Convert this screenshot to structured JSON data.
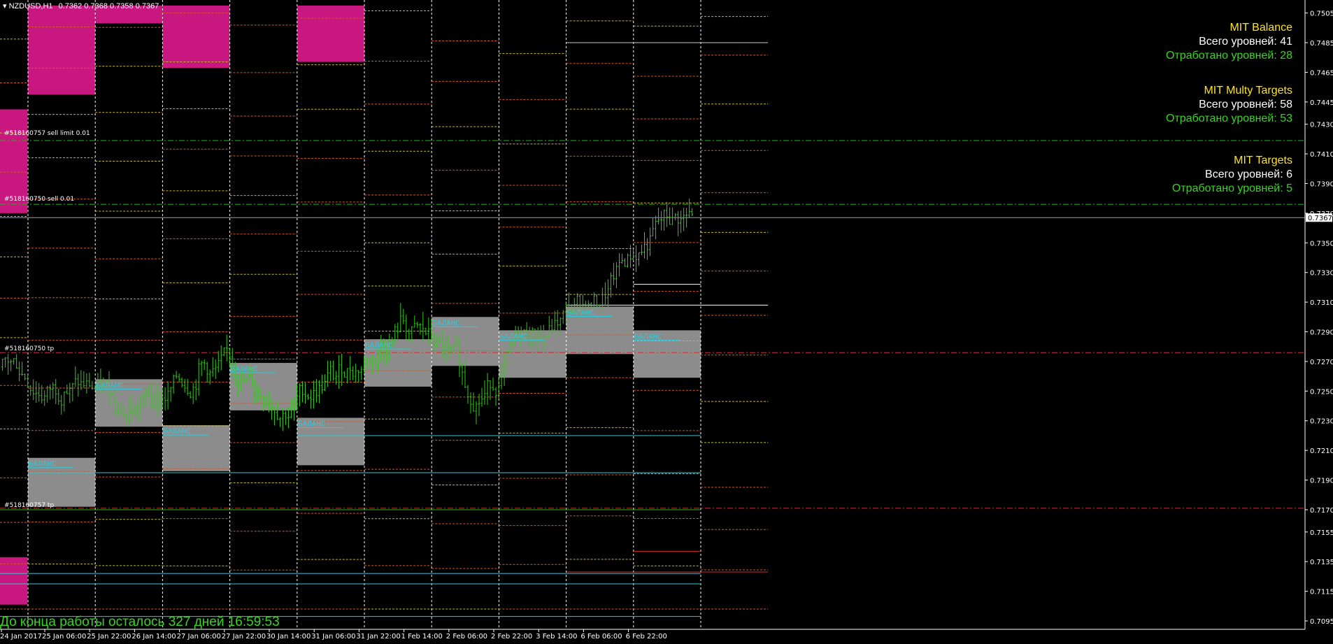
{
  "header": {
    "symbol": "NZDUSD,H1",
    "ohlc": "0.7362 0.7368 0.7358 0.7367"
  },
  "current_price_label": "0.7367",
  "panels": [
    {
      "title": "MIT Balance",
      "total": "Всего уровней: 41",
      "done": "Отработано уровней: 28"
    },
    {
      "title": "MIT Multy Targets",
      "total": "Всего уровней: 58",
      "done": "Отработано уровней: 53"
    },
    {
      "title": "MIT Targets",
      "total": "Всего уровней: 6",
      "done": "Отработано уровней: 5"
    }
  ],
  "orders": [
    {
      "label": "#518160757 sell limit 0.01",
      "price": 0.7419
    },
    {
      "label": "#518160750 sell 0.01",
      "price": 0.7376
    },
    {
      "label": "#518160750 tp",
      "price": 0.7276
    },
    {
      "label": "#518160757 tp",
      "price": 0.7171
    }
  ],
  "countdown": "До конца работы осталось 327 дней 16:59:53",
  "balance_label": "БАЛАНС",
  "colors": {
    "background": "#000000",
    "candle": "#33cc1a",
    "zone_magenta": "#c8177f",
    "zone_gray": "#8c8c8c",
    "grid": "#ffffff",
    "level_orange": "#d4572a",
    "level_yellow": "#c8b432",
    "order_green": "#21b321",
    "order_red": "#d03030",
    "cyan": "#33c8d8",
    "text_yellow": "#ffe21f",
    "text_green": "#36d61f"
  },
  "chart_data": {
    "type": "candlestick",
    "symbol": "NZDUSD",
    "timeframe": "H1",
    "ylim": [
      0.7095,
      0.751
    ],
    "y_ticks": [
      "0.7505",
      "0.7485",
      "0.7465",
      "0.7445",
      "0.7430",
      "0.7410",
      "0.7390",
      "0.7370",
      "0.7350",
      "0.7330",
      "0.7310",
      "0.7290",
      "0.7270",
      "0.7250",
      "0.7230",
      "0.7210",
      "0.7190",
      "0.7170",
      "0.7155",
      "0.7135",
      "0.7115",
      "0.7095"
    ],
    "x_labels": [
      "24 Jan 2017",
      "25 Jan 06:00",
      "25 Jan 22:00",
      "26 Jan 14:00",
      "27 Jan 06:00",
      "27 Jan 22:00",
      "30 Jan 14:00",
      "31 Jan 06:00",
      "31 Jan 22:00",
      "1 Feb 14:00",
      "2 Feb 06:00",
      "2 Feb 22:00",
      "3 Feb 14:00",
      "6 Feb 06:00",
      "6 Feb 22:00"
    ],
    "num_days": 10,
    "last_price": 0.7367,
    "day_closes": [
      0.7262,
      0.7252,
      0.7238,
      0.7262,
      0.7245,
      0.7262,
      0.7295,
      0.725,
      0.729,
      0.731,
      0.7367
    ],
    "balance_zones": [
      {
        "day": 0,
        "top": 0.7205,
        "bottom": 0.7172
      },
      {
        "day": 1,
        "top": 0.7258,
        "bottom": 0.7226
      },
      {
        "day": 2,
        "top": 0.7227,
        "bottom": 0.7196
      },
      {
        "day": 3,
        "top": 0.7269,
        "bottom": 0.7237
      },
      {
        "day": 4,
        "top": 0.7232,
        "bottom": 0.72
      },
      {
        "day": 5,
        "top": 0.7285,
        "bottom": 0.7253
      },
      {
        "day": 6,
        "top": 0.73,
        "bottom": 0.7267
      },
      {
        "day": 7,
        "top": 0.7291,
        "bottom": 0.7259
      },
      {
        "day": 8,
        "top": 0.7307,
        "bottom": 0.7275
      },
      {
        "day": 9,
        "top": 0.7291,
        "bottom": 0.7259
      }
    ],
    "sell_zones": [
      {
        "day": -1,
        "top": 0.744,
        "bottom": 0.737
      },
      {
        "day": -1,
        "top": 0.7138,
        "bottom": 0.7106
      },
      {
        "day": 0,
        "top": 0.751,
        "bottom": 0.745
      },
      {
        "day": 1,
        "top": 0.7498,
        "bottom": 0.751
      },
      {
        "day": 2,
        "top": 0.751,
        "bottom": 0.7468
      },
      {
        "day": 4,
        "top": 0.751,
        "bottom": 0.7472
      }
    ],
    "horizontal_levels": [
      {
        "price": 0.7485,
        "from_day": 8,
        "to_day": 11,
        "color": "#c8c8c8"
      },
      {
        "price": 0.7308,
        "from_day": 8,
        "to_day": 11,
        "color": "#ffffff"
      },
      {
        "price": 0.7322,
        "from_day": 9,
        "to_day": 10,
        "color": "#ffffff"
      },
      {
        "price": 0.722,
        "from_day": 4,
        "to_day": 10,
        "color": "#33c8d8"
      },
      {
        "price": 0.7195,
        "from_day": 0,
        "to_day": 10,
        "color": "#33c8d8"
      },
      {
        "price": 0.7127,
        "from_day": -1,
        "to_day": 10,
        "color": "#33c8d8"
      },
      {
        "price": 0.712,
        "from_day": -1,
        "to_day": 10,
        "color": "#33c8d8"
      },
      {
        "price": 0.7098,
        "from_day": -1,
        "to_day": 10,
        "color": "#33c8d8"
      },
      {
        "price": 0.717,
        "from_day": -1,
        "to_day": 10,
        "color": "#21b321"
      },
      {
        "price": 0.7142,
        "from_day": 9,
        "to_day": 10,
        "color": "#d03030"
      },
      {
        "price": 0.7128,
        "from_day": 8,
        "to_day": 11,
        "color": "#d03030"
      }
    ]
  }
}
